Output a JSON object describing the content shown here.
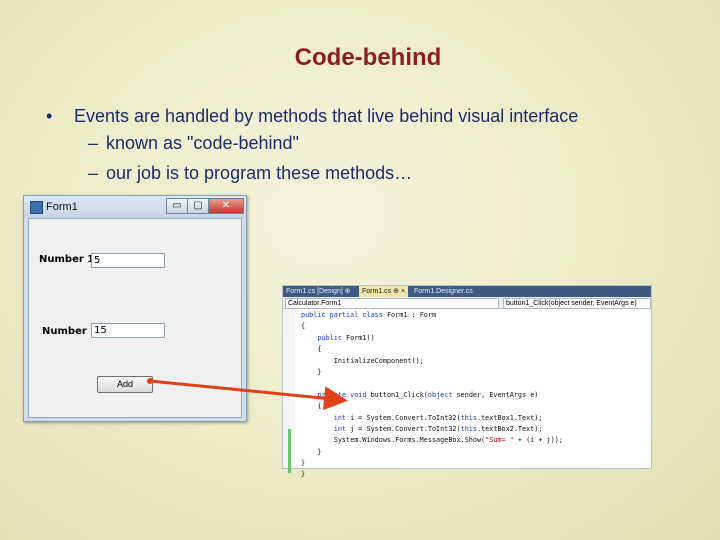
{
  "slide": {
    "title": "Code-behind",
    "bullet": "Events are handled by methods that live behind visual interface",
    "bullet_marker": "•",
    "sub_marker": "–",
    "sub_items": [
      "known as \"code-behind\"",
      "our job is to program these methods…"
    ],
    "colors": {
      "title": "#8b1f1f",
      "text": "#1e2a6e",
      "arrow": "#e0401a"
    }
  },
  "form_window": {
    "caption": "Form1",
    "buttons": {
      "minimize": "▭",
      "maximize": "▢",
      "close": "✕"
    },
    "label1": "Number 1:",
    "value1": "5",
    "label2": "Number 2:",
    "value2": "15",
    "add_button": "Add"
  },
  "editor": {
    "tabs": [
      "Form1.cs [Design]",
      "Form1.cs",
      "Form1.Designer.cs"
    ],
    "tab_pin": "⊕",
    "tab_close": "×",
    "class_combo": "Calculator.Form1",
    "method_combo": "button1_Click(object sender, EventArgs e)",
    "code_lines": [
      "public partial class Form1 : Form",
      "{",
      "    public Form1()",
      "    {",
      "        InitializeComponent();",
      "    }",
      "",
      "    private void button1_Click(object sender, EventArgs e)",
      "    {",
      "        int i = System.Convert.ToInt32(this.textBox1.Text);",
      "        int j = System.Convert.ToInt32(this.textBox2.Text);",
      "        System.Windows.Forms.MessageBox.Show(\"Sum= \" + (i + j));",
      "    }",
      "}",
      "}"
    ]
  }
}
